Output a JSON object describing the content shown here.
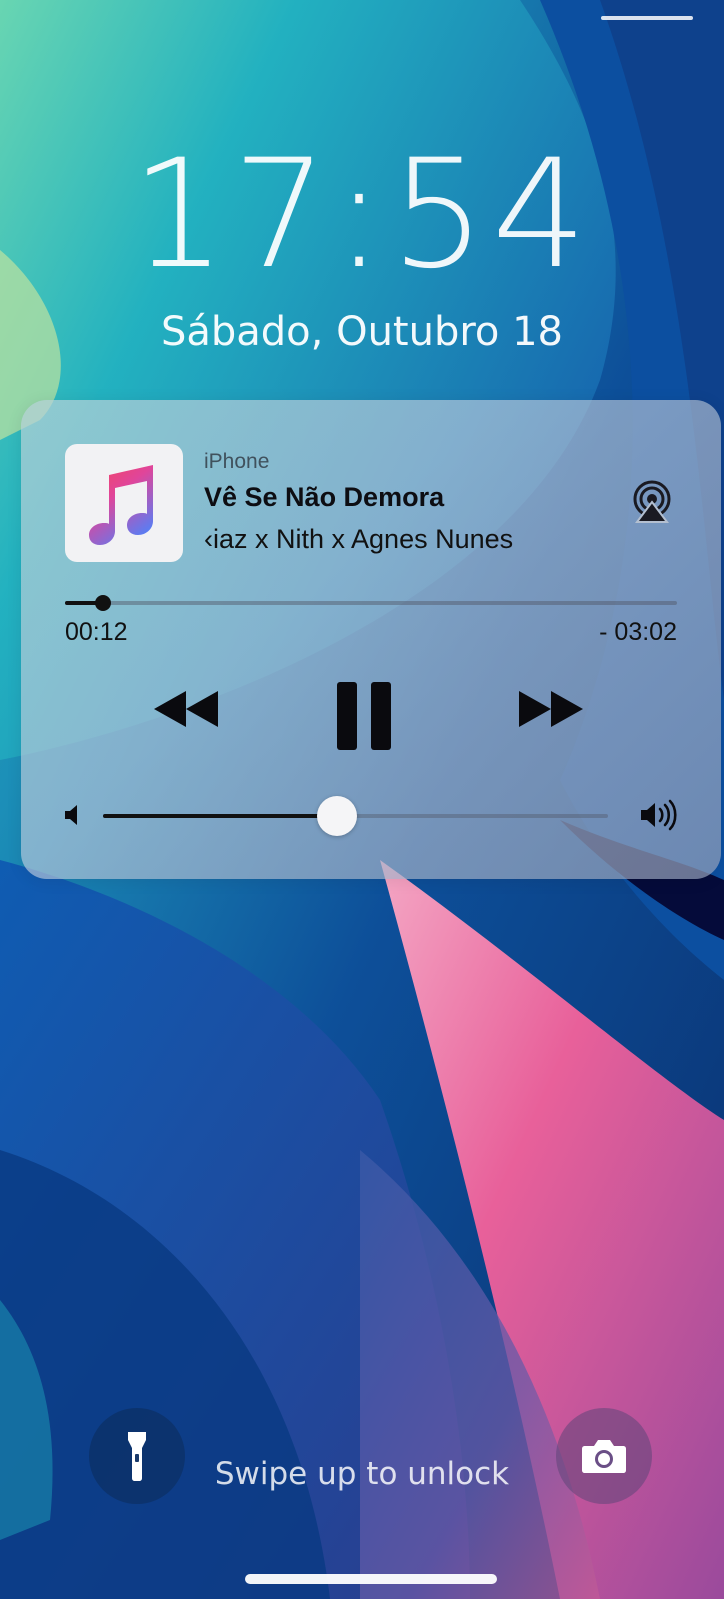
{
  "lock_screen": {
    "time": "17:54",
    "date": "Sábado, Outubro 18",
    "unlock_hint": "Swipe up to unlock"
  },
  "now_playing": {
    "device": "iPhone",
    "title": "Vê Se Não Demora",
    "artist": "Kiaz x Nith x Agnes Nunes",
    "artist_visible": "‹iaz x Nith x Agnes Nunes",
    "elapsed": "00:12",
    "remaining": "- 03:02",
    "progress_fraction": 0.062,
    "volume_fraction": 0.464,
    "icons": {
      "album_art": "music-note-icon",
      "output": "airplay-icon",
      "rewind": "rewind-icon",
      "play_state": "pause-icon",
      "forward": "fast-forward-icon",
      "volume_low": "speaker-low-icon",
      "volume_high": "speaker-high-icon"
    }
  },
  "quick_actions": {
    "left": "flashlight-icon",
    "right": "camera-icon"
  },
  "colors": {
    "accent_pink": "#e8609a",
    "accent_blue": "#1a4fa8",
    "accent_teal": "#1fb6b0"
  }
}
